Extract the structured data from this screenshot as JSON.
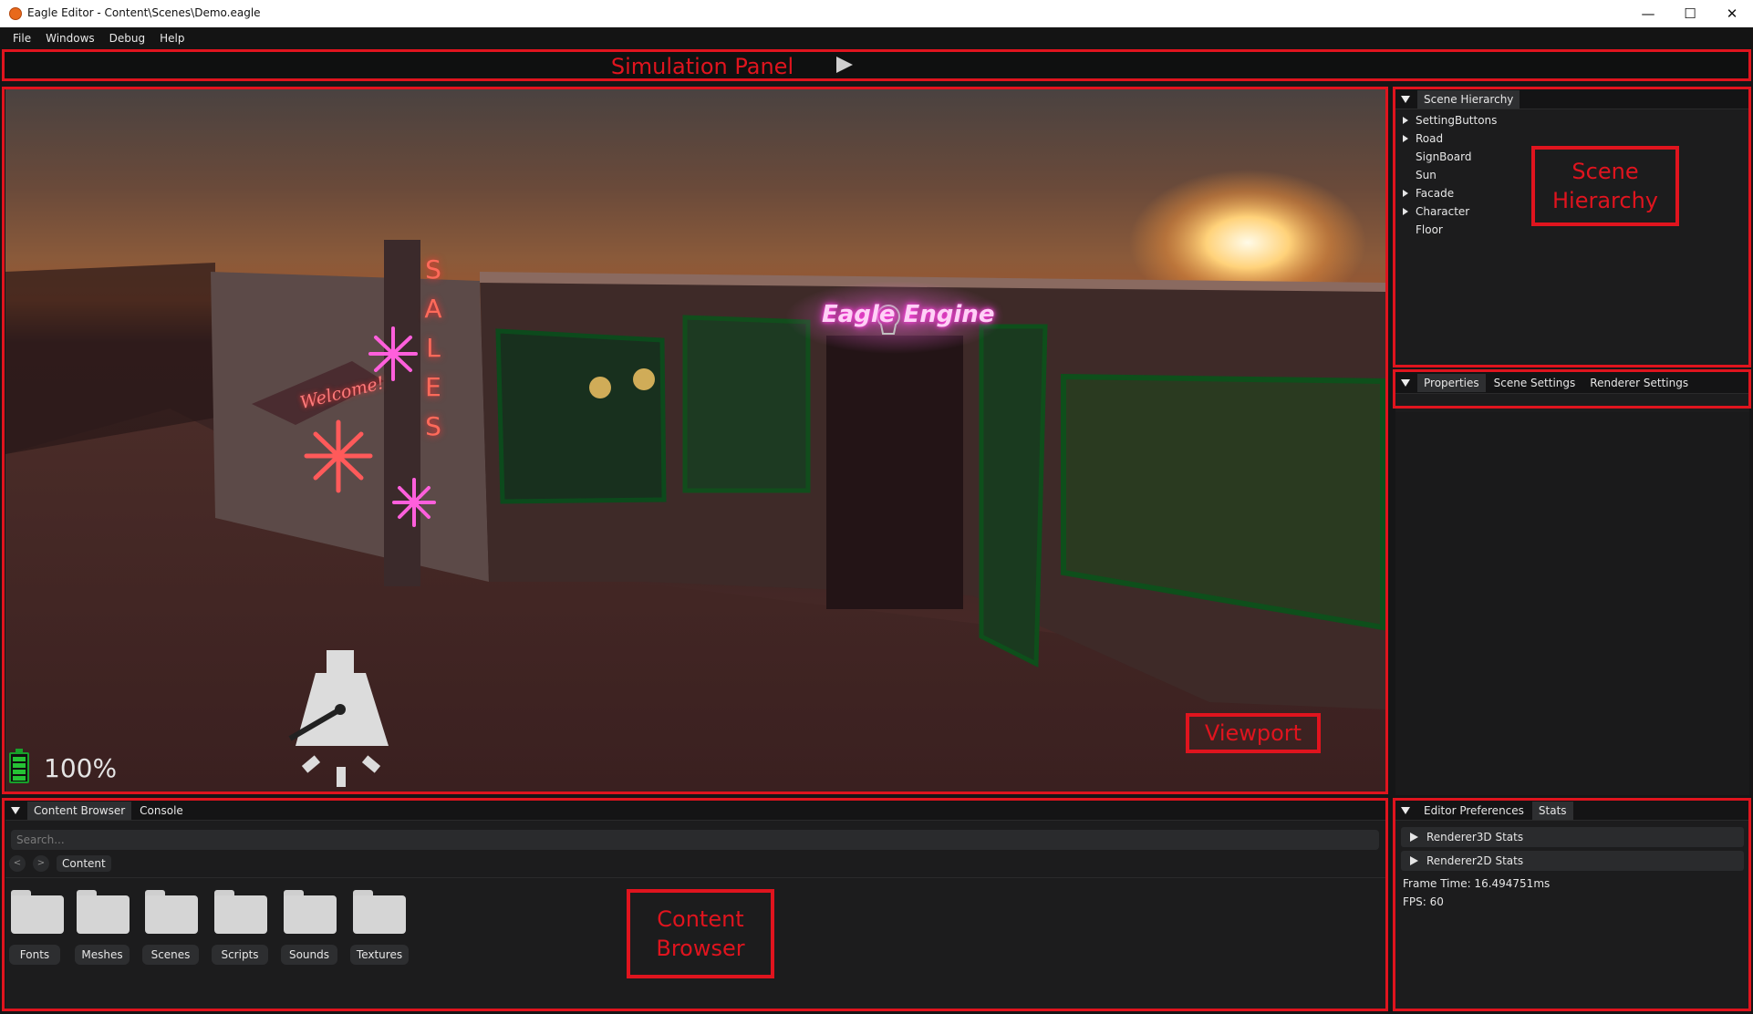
{
  "window": {
    "title": "Eagle Editor - Content\\Scenes\\Demo.eagle",
    "minimize_glyph": "—",
    "maximize_glyph": "☐",
    "close_glyph": "✕"
  },
  "menu": [
    "File",
    "Windows",
    "Debug",
    "Help"
  ],
  "annotations": {
    "simulation_panel": "Simulation Panel",
    "viewport": "Viewport",
    "scene_hierarchy_line1": "Scene",
    "scene_hierarchy_line2": "Hierarchy",
    "content_browser_line1": "Content",
    "content_browser_line2": "Browser"
  },
  "viewport": {
    "battery_percent": "100%",
    "signs": {
      "sales": [
        "S",
        "A",
        "L",
        "E",
        "S"
      ],
      "welcome": "Welcome!",
      "eagle_engine": "Eagle Engine"
    }
  },
  "scene_hierarchy": {
    "tab": "Scene Hierarchy",
    "items": [
      {
        "label": "SettingButtons",
        "expandable": true
      },
      {
        "label": "Road",
        "expandable": true
      },
      {
        "label": "SignBoard",
        "expandable": false
      },
      {
        "label": "Sun",
        "expandable": false
      },
      {
        "label": "Facade",
        "expandable": true
      },
      {
        "label": "Character",
        "expandable": true
      },
      {
        "label": "Floor",
        "expandable": false
      }
    ]
  },
  "properties_panel": {
    "tabs": [
      "Properties",
      "Scene Settings",
      "Renderer Settings"
    ],
    "active_tab": "Properties"
  },
  "content_browser": {
    "tabs": [
      "Content Browser",
      "Console"
    ],
    "search_placeholder": "Search...",
    "back_glyph": "<",
    "forward_glyph": ">",
    "breadcrumb": "Content",
    "folders": [
      "Fonts",
      "Meshes",
      "Scenes",
      "Scripts",
      "Sounds",
      "Textures"
    ]
  },
  "stats_panel": {
    "tabs": [
      "Editor Preferences",
      "Stats"
    ],
    "rows": [
      "Renderer3D Stats",
      "Renderer2D Stats"
    ],
    "frame_time": "Frame Time: 16.494751ms",
    "fps": "FPS: 60"
  },
  "colors": {
    "annotation_red": "#e0141e",
    "panel_bg": "#1c1c1d",
    "neon_pink": "#ff4fd8",
    "neon_red": "#ff4a4a",
    "battery_green": "#25c234"
  }
}
